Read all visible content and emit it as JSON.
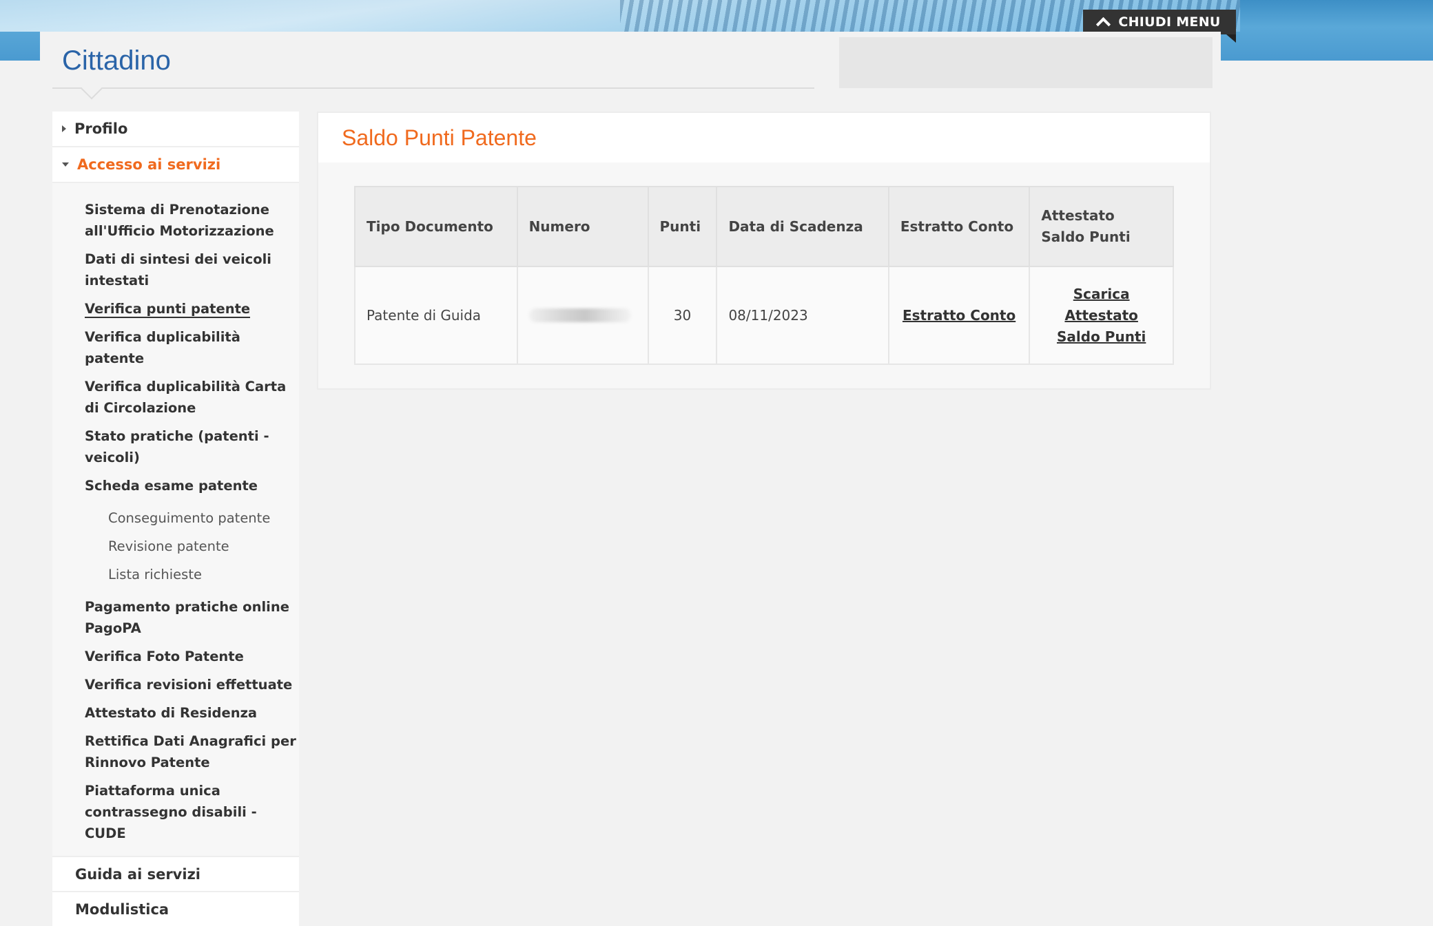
{
  "header": {
    "menu_button": "CHIUDI MENU",
    "title": "Cittadino"
  },
  "sidebar": {
    "profilo": "Profilo",
    "accesso": "Accesso ai servizi",
    "items": [
      "Sistema di Prenotazione all'Ufficio Motorizzazione",
      "Dati di sintesi dei veicoli intestati",
      "Verifica punti patente",
      "Verifica duplicabilità patente",
      "Verifica duplicabilità Carta di Circolazione",
      "Stato pratiche (patenti - veicoli)",
      "Scheda esame patente"
    ],
    "scheda_sub": [
      "Conseguimento patente",
      "Revisione patente",
      "Lista richieste"
    ],
    "items_after": [
      "Pagamento pratiche online PagoPA",
      "Verifica Foto Patente",
      "Verifica revisioni effettuate",
      "Attestato di Residenza",
      "Rettifica Dati Anagrafici per Rinnovo Patente",
      "Piattaforma unica contrassegno disabili - CUDE"
    ],
    "guida": "Guida ai servizi",
    "modulistica": "Modulistica"
  },
  "main": {
    "heading": "Saldo Punti Patente",
    "table": {
      "headers": [
        "Tipo Documento",
        "Numero",
        "Punti",
        "Data di Scadenza",
        "Estratto Conto",
        "Attestato Saldo Punti"
      ],
      "row": {
        "tipo": "Patente di Guida",
        "punti": "30",
        "scadenza": "08/11/2023",
        "estratto": "Estratto Conto",
        "attestato": "Scarica Attestato Saldo Punti"
      }
    }
  },
  "colors": {
    "accent_orange": "#f06a1e",
    "title_blue": "#2a64a8",
    "menu_button_bg": "#333333"
  }
}
